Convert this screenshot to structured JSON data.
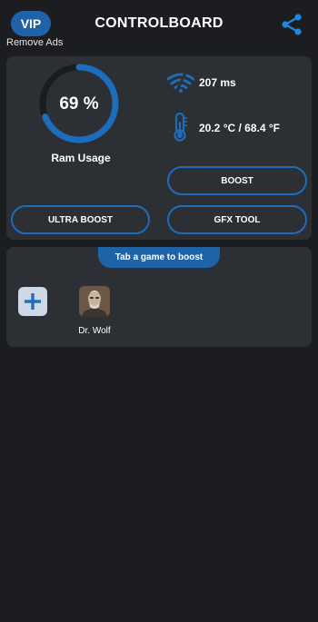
{
  "header": {
    "vip_label": "VIP",
    "remove_ads_label": "Remove Ads",
    "title": "CONTROLBOARD",
    "share_icon": "share-icon"
  },
  "stats": {
    "ram_percent": 69,
    "ram_value_text": "69 %",
    "ram_label": "Ram Usage",
    "ping_text": "207 ms",
    "temperature_text": "20.2 °C / 68.4 °F"
  },
  "buttons": {
    "boost": "BOOST",
    "ultra_boost": "ULTRA BOOST",
    "gfx_tool": "GFX TOOL"
  },
  "games": {
    "prompt": "Tab a game to boost",
    "items": [
      {
        "name": "Dr. Wolf"
      }
    ]
  },
  "colors": {
    "accent": "#1e6dbd",
    "background": "#1c1d20",
    "card": "#2c2f33"
  }
}
